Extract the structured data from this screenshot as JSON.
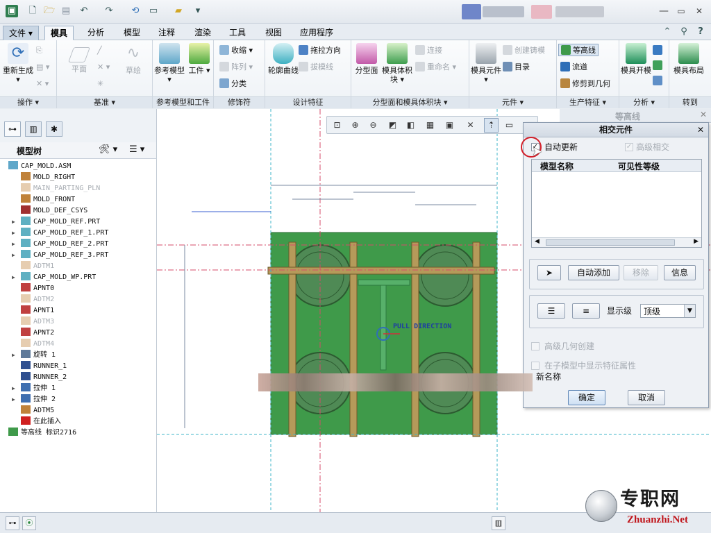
{
  "titlebar": {
    "window_controls": [
      "?",
      "▢",
      "✕"
    ],
    "quick_icons": [
      "app-icon",
      "new-icon",
      "open-icon",
      "save-icon",
      "undo-icon",
      "redo-icon",
      "regenerate-icon",
      "window-icon",
      "folder-icon",
      "more-icon"
    ]
  },
  "tabs": {
    "file": "文件",
    "items": [
      "模具",
      "分析",
      "模型",
      "注释",
      "渲染",
      "工具",
      "视图",
      "应用程序"
    ],
    "active": "模具"
  },
  "ribbon": {
    "groups": {
      "operations": {
        "label": "操作",
        "regenerate": "重新生成"
      },
      "datum": {
        "label": "基准",
        "plane": "平面",
        "sketch": "草绘"
      },
      "reference": {
        "label": "参考模型和工件",
        "ref_model": "参考模型",
        "workpiece": "工件"
      },
      "decoration": {
        "label": "修饰符",
        "shrink": "收缩",
        "pattern": "阵列",
        "classify": "分类"
      },
      "design": {
        "label": "设计特征",
        "silhouette": "轮廓曲线",
        "drag_dir": "拖拉方向",
        "draft_line": "拔模线"
      },
      "parting": {
        "label": "分型面和模具体积块",
        "parting_surface": "分型面",
        "mold_volume": "模具体积块",
        "connect": "连接",
        "rename": "重命名"
      },
      "component": {
        "label": "元件",
        "mold_comp": "模具元件",
        "create_casting": "创建铸模",
        "directory": "目录"
      },
      "production": {
        "label": "生产特征",
        "contour": "等高线",
        "runner": "流道",
        "trim_geom": "修剪到几何"
      },
      "analysis": {
        "label": "分析",
        "mold_open": "模具开模"
      },
      "goto": {
        "label": "转到",
        "mold_layout": "模具布局"
      }
    }
  },
  "model_tree": {
    "title": "模型树",
    "items": [
      {
        "label": "CAP_MOLD.ASM",
        "icon": "assembly-icon",
        "dim": false,
        "expandable": false,
        "indent": 0
      },
      {
        "label": "MOLD_RIGHT",
        "icon": "datum-plane-icon",
        "dim": false,
        "expandable": false,
        "indent": 1
      },
      {
        "label": "MAIN_PARTING_PLN",
        "icon": "datum-plane-icon",
        "dim": true,
        "expandable": false,
        "indent": 1
      },
      {
        "label": "MOLD_FRONT",
        "icon": "datum-plane-icon",
        "dim": false,
        "expandable": false,
        "indent": 1
      },
      {
        "label": "MOLD_DEF_CSYS",
        "icon": "csys-icon",
        "dim": false,
        "expandable": false,
        "indent": 1
      },
      {
        "label": "CAP_MOLD_REF.PRT",
        "icon": "part-icon",
        "dim": false,
        "expandable": true,
        "indent": 1
      },
      {
        "label": "CAP_MOLD_REF_1.PRT",
        "icon": "part-icon",
        "dim": false,
        "expandable": true,
        "indent": 1
      },
      {
        "label": "CAP_MOLD_REF_2.PRT",
        "icon": "part-icon",
        "dim": false,
        "expandable": true,
        "indent": 1
      },
      {
        "label": "CAP_MOLD_REF_3.PRT",
        "icon": "part-icon",
        "dim": false,
        "expandable": true,
        "indent": 1
      },
      {
        "label": "ADTM1",
        "icon": "datum-plane-icon",
        "dim": true,
        "expandable": false,
        "indent": 1
      },
      {
        "label": "CAP_MOLD_WP.PRT",
        "icon": "part-icon",
        "dim": false,
        "expandable": true,
        "indent": 1
      },
      {
        "label": "APNT0",
        "icon": "datum-point-icon",
        "dim": false,
        "expandable": false,
        "indent": 1
      },
      {
        "label": "ADTM2",
        "icon": "datum-plane-icon",
        "dim": true,
        "expandable": false,
        "indent": 1
      },
      {
        "label": "APNT1",
        "icon": "datum-point-icon",
        "dim": false,
        "expandable": false,
        "indent": 1
      },
      {
        "label": "ADTM3",
        "icon": "datum-plane-icon",
        "dim": true,
        "expandable": false,
        "indent": 1
      },
      {
        "label": "APNT2",
        "icon": "datum-point-icon",
        "dim": false,
        "expandable": false,
        "indent": 1
      },
      {
        "label": "ADTM4",
        "icon": "datum-plane-icon",
        "dim": true,
        "expandable": false,
        "indent": 1
      },
      {
        "label": "旋转 1",
        "icon": "revolve-icon",
        "dim": false,
        "expandable": true,
        "indent": 1
      },
      {
        "label": "RUNNER_1",
        "icon": "runner-icon",
        "dim": false,
        "expandable": false,
        "indent": 1
      },
      {
        "label": "RUNNER_2",
        "icon": "runner-icon",
        "dim": false,
        "expandable": false,
        "indent": 1
      },
      {
        "label": "拉伸 1",
        "icon": "extrude-icon",
        "dim": false,
        "expandable": true,
        "indent": 1
      },
      {
        "label": "拉伸 2",
        "icon": "extrude-icon",
        "dim": false,
        "expandable": true,
        "indent": 1
      },
      {
        "label": "ADTM5",
        "icon": "datum-plane-icon",
        "dim": false,
        "expandable": false,
        "indent": 1
      },
      {
        "label": "在此插入",
        "icon": "insert-arrow-icon",
        "dim": false,
        "expandable": false,
        "indent": 1
      },
      {
        "label": "等高线 标识2716",
        "icon": "contour-icon",
        "dim": false,
        "expandable": false,
        "indent": 0
      }
    ]
  },
  "graphics": {
    "annotation": "PULL DIRECTION"
  },
  "contour_panel": {
    "title": "等高线"
  },
  "dialog": {
    "title": "相交元件",
    "auto_update": "自动更新",
    "auto_update_checked": true,
    "advanced_intersect": "高级相交",
    "advanced_intersect_checked": true,
    "columns": [
      "模型名称",
      "可见性等级"
    ],
    "auto_add": "自动添加",
    "remove": "移除",
    "info": "信息",
    "display_level_label": "显示级",
    "display_level_value": "顶级",
    "adv_geom": "高级几何创建",
    "show_feature_attr": "在子模型中显示特征属性",
    "new_name": "新名称",
    "ok": "确定",
    "cancel": "取消"
  },
  "watermark": {
    "cn": "专职网",
    "en": "Zhuanzhi.Net"
  },
  "colors": {
    "workpiece_green": "#3f9a4a",
    "runner_tan": "#b59a5a",
    "datum_red": "#d64b6a",
    "datum_cyan": "#3fb6c8",
    "accent_blue": "#2f6fb7"
  }
}
